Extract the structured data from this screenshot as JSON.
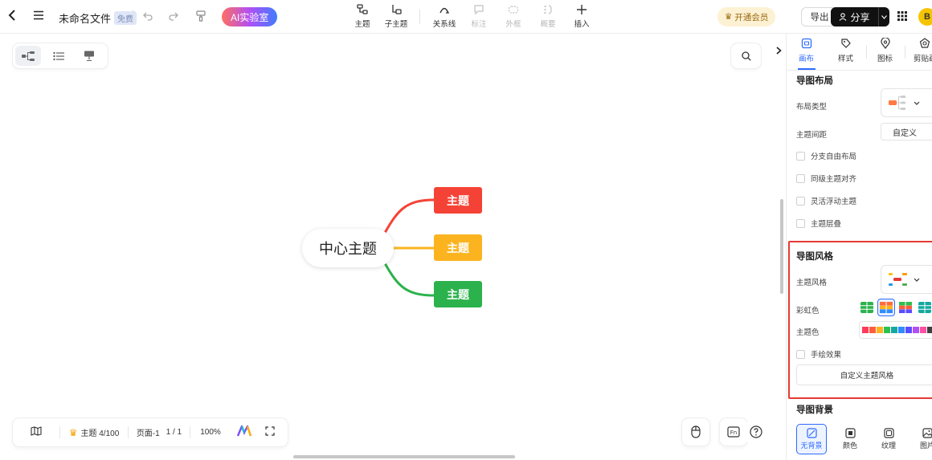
{
  "topbar": {
    "doc_title": "未命名文件",
    "badge": "免费",
    "ai_label": "AI实验室",
    "tools": [
      {
        "label": "主题",
        "icon": "topic-icon",
        "enabled": true
      },
      {
        "label": "子主题",
        "icon": "subtopic-icon",
        "enabled": true
      },
      {
        "label": "关系线",
        "icon": "relation-line-icon",
        "enabled": true
      },
      {
        "label": "标注",
        "icon": "callout-icon",
        "enabled": false
      },
      {
        "label": "外框",
        "icon": "boundary-icon",
        "enabled": false
      },
      {
        "label": "概要",
        "icon": "summary-icon",
        "enabled": false
      },
      {
        "label": "插入",
        "icon": "plus-icon",
        "enabled": true
      }
    ],
    "vip_label": "开通会员",
    "export_label": "导出",
    "share_label": "分享",
    "avatar_text": "B"
  },
  "mindmap": {
    "center": "中心主题",
    "topics": [
      {
        "label": "主题",
        "color": "#f44336"
      },
      {
        "label": "主题",
        "color": "#fbb420"
      },
      {
        "label": "主题",
        "color": "#2bb24c"
      }
    ]
  },
  "statusbar": {
    "topic_count": "主题 4/100",
    "page": "页面-1",
    "page_of": "1 / 1",
    "zoom": "100%"
  },
  "panel": {
    "tabs": [
      {
        "label": "画布",
        "icon": "canvas-icon",
        "active": true
      },
      {
        "label": "样式",
        "icon": "style-icon",
        "active": false
      },
      {
        "label": "图标",
        "icon": "sticker-icon",
        "active": false
      },
      {
        "label": "剪贴画",
        "icon": "clipart-icon",
        "active": false
      }
    ],
    "layout_title": "导图布局",
    "layout_type_label": "布局类型",
    "topic_spacing_label": "主题间距",
    "topic_spacing_value": "自定义",
    "checks": [
      "分支自由布局",
      "同级主题对齐",
      "灵活浮动主题",
      "主题层叠"
    ],
    "style_title": "导图风格",
    "topic_style_label": "主题风格",
    "rainbow_label": "彩虹色",
    "theme_color_label": "主题色",
    "hand_drawn_label": "手绘效果",
    "custom_style_button": "自定义主题风格",
    "background_title": "导图背景",
    "bg_options": [
      {
        "label": "无背景",
        "icon": "no-background-icon",
        "active": true
      },
      {
        "label": "颜色",
        "icon": "color-icon",
        "active": false
      },
      {
        "label": "纹理",
        "icon": "texture-icon",
        "active": false
      },
      {
        "label": "图片",
        "icon": "image-icon",
        "active": false
      }
    ],
    "theme_colors": [
      "#ff3b5c",
      "#ff5d3b",
      "#ffb21e",
      "#2fbf4f",
      "#15a8a0",
      "#2f8cff",
      "#5a4cff",
      "#b14ff5",
      "#ff4fa3",
      "#3f3f3f",
      "#1c6ef2"
    ]
  }
}
